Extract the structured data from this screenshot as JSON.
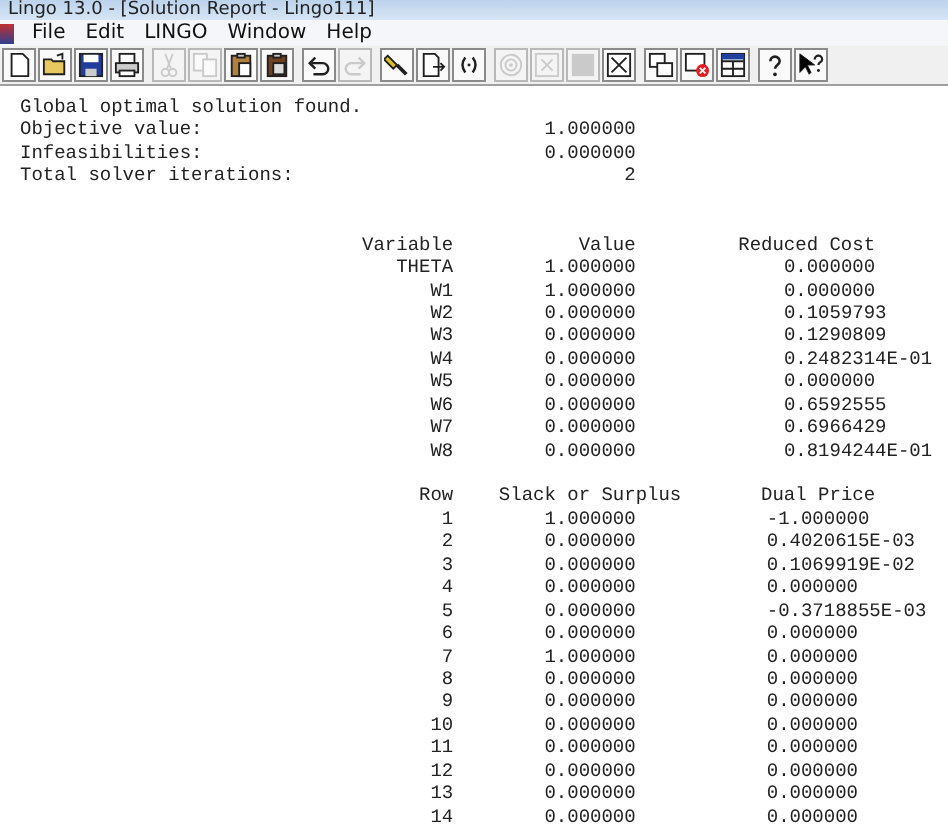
{
  "window": {
    "title": "Lingo 13.0 - [Solution Report - Lingo111]"
  },
  "menu": [
    "File",
    "Edit",
    "LINGO",
    "Window",
    "Help"
  ],
  "toolbar": [
    [
      {
        "disabled": false
      },
      {
        "disabled": false
      },
      {
        "disabled": false
      },
      {
        "disabled": false
      }
    ],
    [
      {
        "disabled": true
      },
      {
        "disabled": true
      },
      {
        "disabled": false
      },
      {
        "disabled": false
      }
    ],
    [
      {
        "disabled": false
      },
      {
        "disabled": true
      }
    ],
    [
      {
        "disabled": false
      },
      {
        "disabled": false
      },
      {
        "disabled": false
      }
    ],
    [
      {
        "disabled": true
      },
      {
        "disabled": true
      },
      {
        "disabled": true
      },
      {
        "disabled": false
      }
    ],
    [
      {
        "disabled": false
      },
      {
        "disabled": false
      },
      {
        "disabled": false
      }
    ],
    [
      {
        "disabled": false
      },
      {
        "disabled": false
      }
    ]
  ],
  "report": {
    "summary": [
      {
        "label": "Global optimal solution found."
      },
      {
        "label": "Objective value:",
        "value": "1.000000"
      },
      {
        "label": "Infeasibilities:",
        "value": "0.000000"
      },
      {
        "label": "Total solver iterations:",
        "value": "2"
      }
    ],
    "variables": {
      "columns": [
        "Variable",
        "Value",
        "Reduced Cost"
      ],
      "rows": [
        [
          "THETA",
          "1.000000",
          "0.000000"
        ],
        [
          "W1",
          "1.000000",
          "0.000000"
        ],
        [
          "W2",
          "0.000000",
          "0.1059793"
        ],
        [
          "W3",
          "0.000000",
          "0.1290809"
        ],
        [
          "W4",
          "0.000000",
          "0.2482314E-01"
        ],
        [
          "W5",
          "0.000000",
          "0.000000"
        ],
        [
          "W6",
          "0.000000",
          "0.6592555"
        ],
        [
          "W7",
          "0.000000",
          "0.6966429"
        ],
        [
          "W8",
          "0.000000",
          "0.8194244E-01"
        ]
      ]
    },
    "rows": {
      "columns": [
        "Row",
        "Slack or Surplus",
        "Dual Price"
      ],
      "rows": [
        [
          "1",
          "1.000000",
          "-1.000000"
        ],
        [
          "2",
          "0.000000",
          "0.4020615E-03"
        ],
        [
          "3",
          "0.000000",
          "0.1069919E-02"
        ],
        [
          "4",
          "0.000000",
          "0.000000"
        ],
        [
          "5",
          "0.000000",
          "-0.3718855E-03"
        ],
        [
          "6",
          "0.000000",
          "0.000000"
        ],
        [
          "7",
          "1.000000",
          "0.000000"
        ],
        [
          "8",
          "0.000000",
          "0.000000"
        ],
        [
          "9",
          "0.000000",
          "0.000000"
        ],
        [
          "10",
          "0.000000",
          "0.000000"
        ],
        [
          "11",
          "0.000000",
          "0.000000"
        ],
        [
          "12",
          "0.000000",
          "0.000000"
        ],
        [
          "13",
          "0.000000",
          "0.000000"
        ],
        [
          "14",
          "0.000000",
          "0.000000"
        ]
      ]
    }
  }
}
